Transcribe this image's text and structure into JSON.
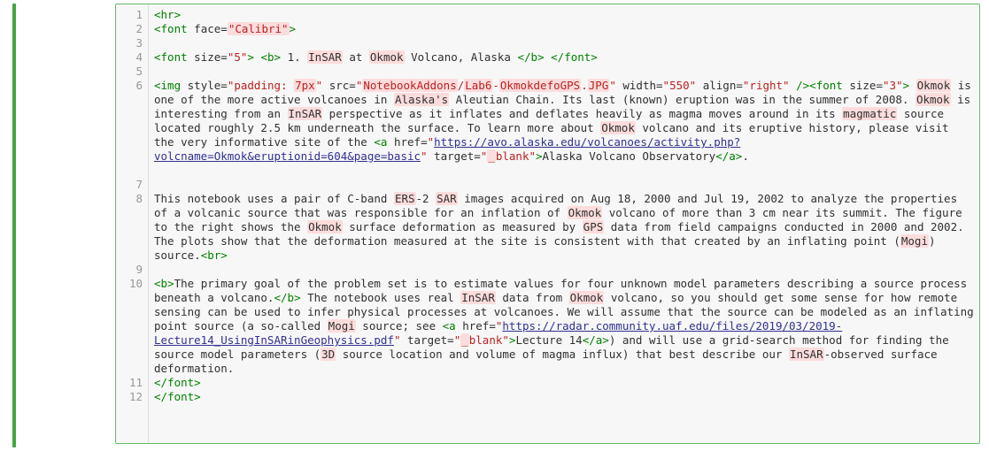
{
  "gutter": [
    "1",
    "2",
    "3",
    "4",
    "5",
    "6",
    "7",
    "8",
    "9",
    "10",
    "11",
    "12"
  ],
  "tokens": {
    "t_hr_open": "<",
    "t_hr_tag": "hr",
    "t_hr_close": ">",
    "t_font1_open": "<",
    "t_font1_tag": "font",
    "t_font1_sp": " ",
    "t_font1_attr": "face",
    "t_font1_eq": "=",
    "t_font1_val": "\"Calibri\"",
    "t_font1_close": ">",
    "t_font2_open": "<",
    "t_font2_tag": "font",
    "t_font2_sp": " ",
    "t_font2_attr": "size",
    "t_font2_eq": "=",
    "t_font2_val": "\"5\"",
    "t_font2_close": ">",
    "t_b_open": " <",
    "t_b_tag": "b",
    "t_b_close": "> ",
    "t_txt_num": "1. ",
    "t_txt_insar1": "InSAR",
    "t_txt_at": " at ",
    "t_txt_okmok1": "Okmok",
    "t_txt_rest1": " Volcano, Alaska ",
    "t_b2_open": "</",
    "t_b2_tag": "b",
    "t_b2_close": ">",
    "t_font2b_open": " </",
    "t_font2b_tag": "font",
    "t_font2b_close": ">",
    "t_img_open": "<",
    "t_img_tag": "img",
    "t_img_sp1": " ",
    "t_img_a1": "style",
    "t_img_e1": "=",
    "t_img_v1a": "\"padding: ",
    "t_img_v1b": "7px",
    "t_img_v1c": "\"",
    "t_img_sp2": " ",
    "t_img_a2": "src",
    "t_img_e2": "=",
    "t_img_v2a": "\"",
    "t_img_v2b": "NotebookAddons",
    "t_img_v2c": "/",
    "t_img_v2d": "Lab6",
    "t_img_v2e": "-",
    "t_img_v2f": "OkmokdefoGPS",
    "t_img_v2g": ".",
    "t_img_v2h": "JPG",
    "t_img_v2i": "\"",
    "t_img_sp3": " ",
    "t_img_a3": "width",
    "t_img_e3": "=",
    "t_img_v3": "\"550\"",
    "t_img_sp4": " ",
    "t_img_a4": "align",
    "t_img_e4": "=",
    "t_img_v4": "\"right\"",
    "t_img_close": " />",
    "t_font3_open": "<",
    "t_font3_tag": "font",
    "t_font3_sp": " ",
    "t_font3_attr": "size",
    "t_font3_eq": "=",
    "t_font3_val": "\"3\"",
    "t_font3_close": ">",
    "t_p1_a": " ",
    "t_p1_ok1": "Okmok",
    "t_p1_b": " is one of the more active volcanoes in ",
    "t_p1_ak": "Alaska's",
    "t_p1_c": " Aleutian Chain. Its last (known) eruption was in the summer of 2008. ",
    "t_p1_ok2": "Okmok",
    "t_p1_d": " is interesting from an ",
    "t_p1_insar": "InSAR",
    "t_p1_e": " perspective as it inflates and deflates heavily as magma moves around in its ",
    "t_p1_mag": "magmatic",
    "t_p1_f": " source located roughly 2.5 km underneath the surface. To learn more about ",
    "t_p1_ok3": "Okmok",
    "t_p1_g": " volcano and its eruptive history, please visit the very informative site of the ",
    "t_a1_open": "<",
    "t_a1_tag": "a",
    "t_a1_sp": " ",
    "t_a1_attr": "href",
    "t_a1_eq": "=",
    "t_a1_q": "\"",
    "t_a1_url": "https://avo.alaska.edu/volcanoes/activity.php?volcname=Okmok&eruptionid=604&page=basic",
    "t_a1_q2": "\"",
    "t_a1_sp2": " ",
    "t_a1_attr2": "target",
    "t_a1_eq2": "=",
    "t_a1_v2a": "\"",
    "t_a1_v2b": "_",
    "t_a1_v2c": "blank\"",
    "t_a1_close": ">",
    "t_a1_txt": "Alaska Volcano Observatory",
    "t_a1c_open": "</",
    "t_a1c_tag": "a",
    "t_a1c_close": ">",
    "t_p1_end": ".",
    "t_p2_a": "This notebook uses a pair of C-band ",
    "t_p2_ers": "ERS",
    "t_p2_b": "-2 ",
    "t_p2_sar": "SAR",
    "t_p2_c": " images acquired on Aug 18, 2000 and Jul 19, 2002 to analyze the properties of a volcanic source that was responsible for an inflation of ",
    "t_p2_ok": "Okmok",
    "t_p2_d": " volcano of more than 3 cm near its summit. The figure to the right shows the ",
    "t_p2_ok2": "Okmok",
    "t_p2_e": " surface deformation as measured by ",
    "t_p2_gps": "GPS",
    "t_p2_f": " data from field campaigns conducted in 2000 and 2002. The plots show that the deformation measured at the site is consistent with that created by an inflating point (",
    "t_p2_mogi": "Mogi",
    "t_p2_g": ") source.",
    "t_br_open": "<",
    "t_br_tag": "br",
    "t_br_close": ">",
    "t_b3_open": "<",
    "t_b3_tag": "b",
    "t_b3_close": ">",
    "t_p3_a": "The primary goal of the problem set is to estimate values for four unknown model parameters describing a source process beneath a volcano.",
    "t_b3c_open": "</",
    "t_b3c_tag": "b",
    "t_b3c_close": ">",
    "t_p3_b": " The notebook uses real ",
    "t_p3_insar": "InSAR",
    "t_p3_c": " data from ",
    "t_p3_ok": "Okmok",
    "t_p3_d": " volcano, so you should get some sense for how remote sensing can be used to infer physical processes at volcanoes. We will assume that the source can be modeled as an inflating point source (a so-called ",
    "t_p3_mogi": "Mogi",
    "t_p3_e": " source; see ",
    "t_a2_open": "<",
    "t_a2_tag": "a",
    "t_a2_sp": " ",
    "t_a2_attr": "href",
    "t_a2_eq": "=",
    "t_a2_q": "\"",
    "t_a2_url": "https://radar.community.uaf.edu/files/2019/03/2019-Lecture14_UsingInSARinGeophysics.pdf",
    "t_a2_q2": "\"",
    "t_a2_sp2": " ",
    "t_a2_attr2": "target",
    "t_a2_eq2": "=",
    "t_a2_v2a": "\"",
    "t_a2_v2b": "_",
    "t_a2_v2c": "blank\"",
    "t_a2_close": ">",
    "t_a2_txt": "Lecture 14",
    "t_a2c_open": "</",
    "t_a2c_tag": "a",
    "t_a2c_close": ">",
    "t_p3_f": ") and will use a grid-search method for finding the source model parameters (",
    "t_p3_3d": "3D",
    "t_p3_g": " source location and volume of magma influx) that best describe our ",
    "t_p3_insar2": "InSAR",
    "t_p3_h": "-observed surface deformation.",
    "t_cf1_o": "</",
    "t_cf1_t": "font",
    "t_cf1_c": ">",
    "t_cf2_o": "</",
    "t_cf2_t": "font",
    "t_cf2_c": ">"
  }
}
